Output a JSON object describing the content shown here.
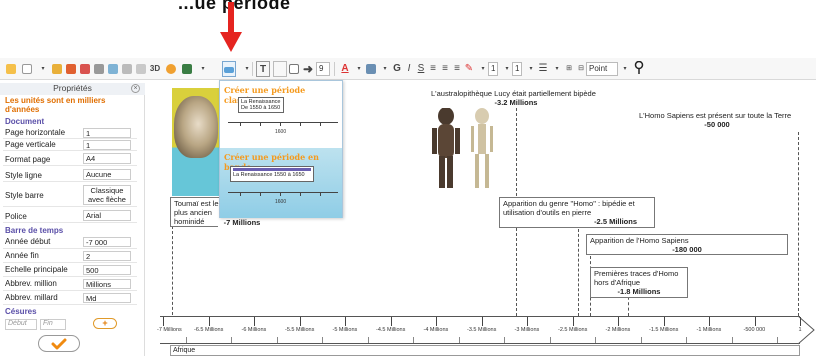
{
  "header": {
    "partial_label": "...ue periode"
  },
  "toolbar": {
    "text_tool": "T",
    "arrow_num": "9",
    "font_color": "A",
    "bold": "G",
    "italic": "I",
    "underline": "S",
    "size_a": "1",
    "size_b": "1",
    "unit": "Point",
    "location_icon": "map-pin-icon"
  },
  "left_panel": {
    "title": "Propriétés",
    "note": "Les unités sont en milliers d'années",
    "document_section": "Document",
    "rows": [
      {
        "label": "Page horizontale",
        "value": "1"
      },
      {
        "label": "Page verticale",
        "value": "1"
      },
      {
        "label": "Format page",
        "value": "A4"
      },
      {
        "label": "Style ligne",
        "value": "Aucune"
      },
      {
        "label": "Style barre",
        "value": "Classique avec flèche"
      },
      {
        "label": "Police",
        "value": "Arial"
      }
    ],
    "timeline_section": "Barre de temps",
    "timeline_rows": [
      {
        "label": "Année début",
        "value": "-7 000"
      },
      {
        "label": "Année fin",
        "value": "2"
      },
      {
        "label": "Echelle principale",
        "value": "500"
      },
      {
        "label": "Abbrev. million",
        "value": "Millions"
      },
      {
        "label": "Abbrev. millard",
        "value": "Md"
      }
    ],
    "cesures_section": "Césures",
    "debut_placeholder": "Début",
    "fin_placeholder": "Fin",
    "add_label": "+"
  },
  "popup": {
    "classic_title": "Créer une période classique",
    "classic_box": "La Renaissance De 1550 à 1650",
    "classic_num": "1600",
    "band_title": "Créer une période en bande",
    "band_box": "La Renaissance 1550 à 1650",
    "band_num": "1600"
  },
  "events": [
    {
      "text": "L'australopithèque Lucy était partiellement bipède",
      "year": "-3.2 Millions"
    },
    {
      "text": "L'Homo Sapiens est présent sur toute la Terre",
      "year": "-50 000"
    },
    {
      "text": "Toumaï est le plus ancien hominidé connu des hommes",
      "year": "-7 Millions"
    },
    {
      "text": "Apparition du genre \"Homo\" : bipédie et utilisation d'outils en pierre",
      "year": "-2.5 Millions"
    },
    {
      "text": "Apparition de l'Homo Sapiens",
      "year": "-180 000"
    },
    {
      "text": "Premières traces d'Homo hors d'Afrique",
      "year": "-1.8 Millions"
    }
  ],
  "timeline": {
    "labels": [
      "-7 Millions",
      "-6.5 Millions",
      "-6 Millions",
      "-5.5 Millions",
      "-5 Millions",
      "-4.5 Millions",
      "-4 Millions",
      "-3.5 Millions",
      "-3 Millions",
      "-2.5 Millions",
      "-2 Millions",
      "-1.5 Millions",
      "-1 Millions",
      "-500 000",
      "1"
    ],
    "band_label": "Afrique"
  },
  "colors": {
    "accent_orange": "#f59a1d",
    "section_purple": "#5a4fa8",
    "arrow_red": "#e52420"
  }
}
